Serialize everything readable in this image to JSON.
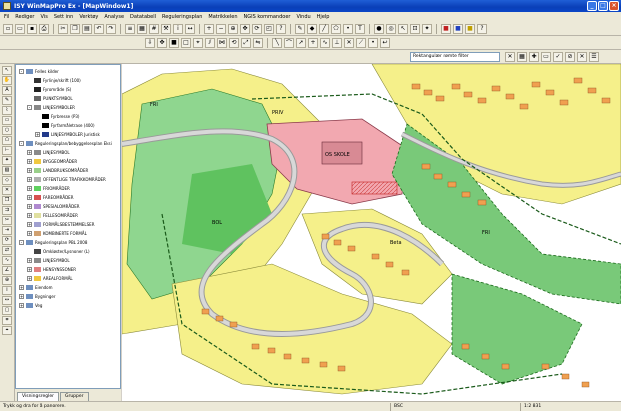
{
  "window": {
    "title": "ISY WinMapPro Ex - [MapWindow1]"
  },
  "menu": [
    "Fil",
    "Rediger",
    "Vis",
    "Sett inn",
    "Verktøy",
    "Analyse",
    "Datatabell",
    "Reguleringsplan",
    "Matrikkelen",
    "NGIS kommandoer",
    "Vindu",
    "Hjelp"
  ],
  "filter": {
    "placeholder": "Rektangulær rømte filter"
  },
  "tree": {
    "nodes": [
      {
        "label": "Felles kilder",
        "level": 1,
        "exp": "-",
        "icon": "#6e8fbf"
      },
      {
        "label": "Fyrlinje/skrift (100)",
        "level": 2,
        "exp": "",
        "icon": "#333"
      },
      {
        "label": "Fyrområde (S)",
        "level": 2,
        "exp": "",
        "icon": "#222"
      },
      {
        "label": "PUNKTSYMBOL",
        "level": 2,
        "exp": "",
        "icon": "#666"
      },
      {
        "label": "LINJESYMBOLER",
        "level": 2,
        "exp": "-",
        "icon": "#888"
      },
      {
        "label": "Fyrbresse (P3)",
        "level": 3,
        "exp": "",
        "icon": "#000"
      },
      {
        "label": "Fyrfarmåletrase (400)",
        "level": 3,
        "exp": "",
        "icon": "#000"
      },
      {
        "label": "LINJESYMBOLER Juristisk",
        "level": 3,
        "exp": "+",
        "icon": "#223a8a"
      },
      {
        "label": "Reguleringsplan/bebyggelsesplan Eksi",
        "level": 1,
        "exp": "-",
        "icon": "#6e8fbf"
      },
      {
        "label": "LINJESYMBOL",
        "level": 2,
        "exp": "+",
        "icon": "#8a8a8a"
      },
      {
        "label": "BYGGEOMRÅDER",
        "level": 2,
        "exp": "+",
        "icon": "#f0c840"
      },
      {
        "label": "LANDBRUKSOMRÅDER",
        "level": 2,
        "exp": "+",
        "icon": "#9ad08a"
      },
      {
        "label": "OFFENTLIGE TRAFIKKOMRÅDER",
        "level": 2,
        "exp": "+",
        "icon": "#b0b0b0"
      },
      {
        "label": "FRIOMRÅDER",
        "level": 2,
        "exp": "+",
        "icon": "#5fd15f"
      },
      {
        "label": "FAREOMRÅDER",
        "level": 2,
        "exp": "+",
        "icon": "#d85050"
      },
      {
        "label": "SPESIALOMRÅDER",
        "level": 2,
        "exp": "+",
        "icon": "#b08ad0"
      },
      {
        "label": "FELLESOMRÅDER",
        "level": 2,
        "exp": "+",
        "icon": "#e0e0a0"
      },
      {
        "label": "FORMÅLSBESTEMMELSER",
        "level": 2,
        "exp": "+",
        "icon": "#a0a0d0"
      },
      {
        "label": "KOMBINERTE FORMÅL",
        "level": 2,
        "exp": "+",
        "icon": "#d0a070"
      },
      {
        "label": "Reguleringsplan PBL 2008",
        "level": 1,
        "exp": "-",
        "icon": "#6e8fbf"
      },
      {
        "label": "Omkløster/Lysnoner (L)",
        "level": 2,
        "exp": "",
        "icon": "#444"
      },
      {
        "label": "LINJESYMBOL",
        "level": 2,
        "exp": "+",
        "icon": "#8a8a8a"
      },
      {
        "label": "HENSYNSSONER",
        "level": 2,
        "exp": "+",
        "icon": "#e08080"
      },
      {
        "label": "AREALFORMÅL",
        "level": 2,
        "exp": "+",
        "icon": "#f0c840"
      },
      {
        "label": "Eiendom",
        "level": 1,
        "exp": "+",
        "icon": "#6e8fbf"
      },
      {
        "label": "Bygninger",
        "level": 1,
        "exp": "+",
        "icon": "#6e8fbf"
      },
      {
        "label": "Veg",
        "level": 1,
        "exp": "+",
        "icon": "#6e8fbf"
      }
    ]
  },
  "tabs": [
    "Visningsregler",
    "Grupper"
  ],
  "status": {
    "hint": "Trykk og dra for å panorere.",
    "code": "BSC",
    "scale": "1:2 831"
  },
  "map_labels": {
    "school": "OS SKOLE",
    "zone_a": "FRI",
    "zone_b": "BOL",
    "zone_c": "FRI",
    "zone_d": "PRIV",
    "zone_e": "Beta"
  }
}
